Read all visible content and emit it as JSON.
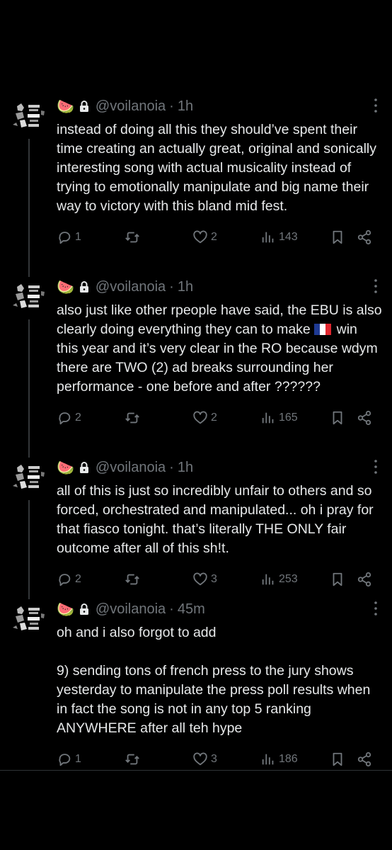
{
  "colors": {
    "background": "#000000",
    "text": "#e7e9ea",
    "muted": "#71767b",
    "thread_line": "#333639"
  },
  "icons": {
    "melon": "🍉",
    "lock": "lock-icon",
    "flag": "france-flag",
    "reply": "reply-icon",
    "retweet": "retweet-icon",
    "like": "heart-icon",
    "views": "views-icon",
    "bookmark": "bookmark-icon",
    "share": "share-icon",
    "more": "more-icon"
  },
  "tweets": [
    {
      "handle": "@voilanoia",
      "time": "1h",
      "text": "instead of doing all this they should’ve spent their time creating an actually great, original and sonically interesting song with actual musicality instead of trying to emotionally manipulate and big name their way to victory with this bland mid fest.",
      "replies": "1",
      "retweets": "",
      "likes": "2",
      "views": "143"
    },
    {
      "handle": "@voilanoia",
      "time": "1h",
      "text_before_flag": "also just like other rpeople have said, the EBU is also clearly doing everything they can to make ",
      "text_after_flag": " win this year and it’s very clear in the RO because wdym there are TWO (2) ad breaks surrounding her performance - one before and after ??????",
      "replies": "2",
      "retweets": "",
      "likes": "2",
      "views": "165"
    },
    {
      "handle": "@voilanoia",
      "time": "1h",
      "text": "all of this is just so incredibly unfair to others and so forced, orchestrated and manipulated... oh i pray for that fiasco tonight. that’s literally THE ONLY fair outcome after all of this sh!t.",
      "replies": "2",
      "retweets": "",
      "likes": "3",
      "views": "253"
    },
    {
      "handle": "@voilanoia",
      "time": "45m",
      "text": "oh and i also forgot to add\n\n9) sending tons of french press to the jury shows yesterday to manipulate the press poll results when in fact the song is not in any top 5 ranking ANYWHERE after all teh hype",
      "replies": "1",
      "retweets": "",
      "likes": "3",
      "views": "186"
    }
  ]
}
